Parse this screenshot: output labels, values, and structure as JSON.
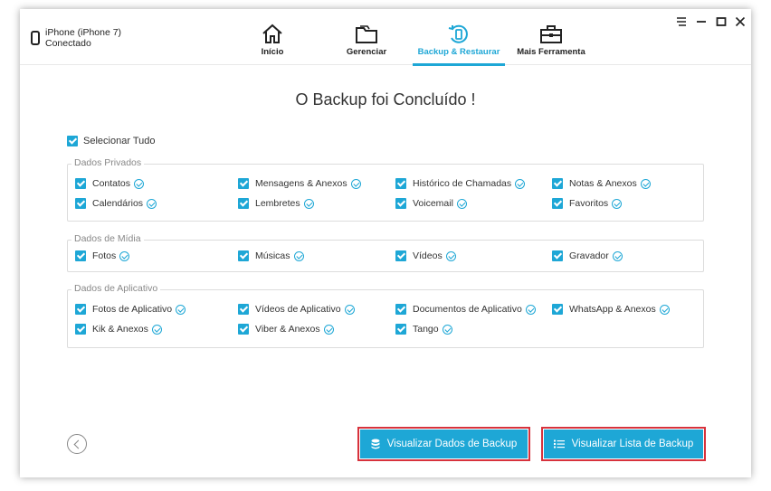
{
  "device": {
    "name": "iPhone (iPhone 7)",
    "status": "Conectado"
  },
  "tabs": [
    {
      "label": "Início",
      "icon": "home-icon"
    },
    {
      "label": "Gerenciar",
      "icon": "folder-icon"
    },
    {
      "label": "Backup & Restaurar",
      "icon": "backup-restore-icon",
      "active": true
    },
    {
      "label": "Mais Ferramenta",
      "icon": "toolbox-icon"
    }
  ],
  "window_controls": [
    "menu-icon",
    "minimize-icon",
    "maximize-icon",
    "close-icon"
  ],
  "title": "O Backup foi Concluído !",
  "select_all": "Selecionar Tudo",
  "groups": {
    "private": {
      "legend": "Dados Privados",
      "items": [
        "Contatos",
        "Mensagens & Anexos",
        "Histórico de Chamadas",
        "Notas & Anexos",
        "Calendários",
        "Lembretes",
        "Voicemail",
        "Favoritos"
      ]
    },
    "media": {
      "legend": "Dados de Mídia",
      "items": [
        "Fotos",
        "Músicas",
        "Vídeos",
        "Gravador"
      ]
    },
    "app": {
      "legend": "Dados de Aplicativo",
      "items": [
        "Fotos de Aplicativo",
        "Vídeos de Aplicativo",
        "Documentos de Aplicativo",
        "WhatsApp & Anexos",
        "Kik & Anexos",
        "Viber & Anexos",
        "Tango"
      ]
    }
  },
  "buttons": {
    "view_data": "Visualizar Dados de Backup",
    "view_list": "Visualizar Lista de Backup"
  },
  "colors": {
    "accent": "#1ea7d6",
    "highlight": "#d7323c"
  }
}
